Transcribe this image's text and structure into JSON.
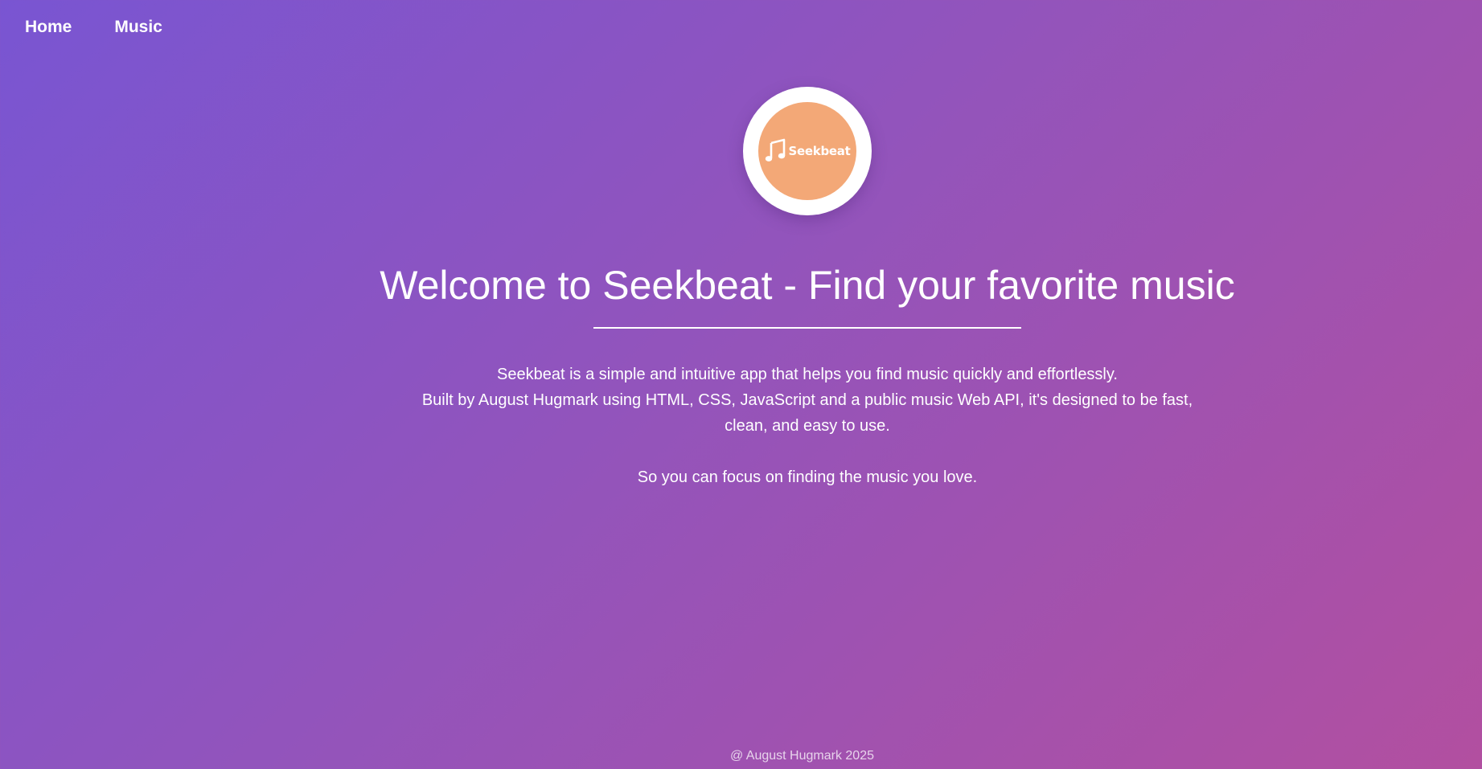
{
  "nav": {
    "items": [
      {
        "label": "Home"
      },
      {
        "label": "Music"
      }
    ]
  },
  "logo": {
    "icon": "music-note-icon",
    "wordmark": "Seekbeat",
    "ring_color": "#ffffff",
    "fill_color": "#f3a877"
  },
  "hero": {
    "title": "Welcome to Seekbeat - Find your favorite music",
    "description_line1": "Seekbeat is a simple and intuitive app that helps you find music quickly and effortlessly.",
    "description_line2": "Built by August Hugmark using HTML, CSS, JavaScript and a public music Web API, it's designed to be fast, clean, and easy to use.",
    "tagline": "So you can focus on finding the music you love."
  },
  "footer": {
    "text": "@ August Hugmark 2025"
  },
  "colors": {
    "gradient_start": "#7955d2",
    "gradient_end": "#b24fa0",
    "text": "#ffffff"
  }
}
